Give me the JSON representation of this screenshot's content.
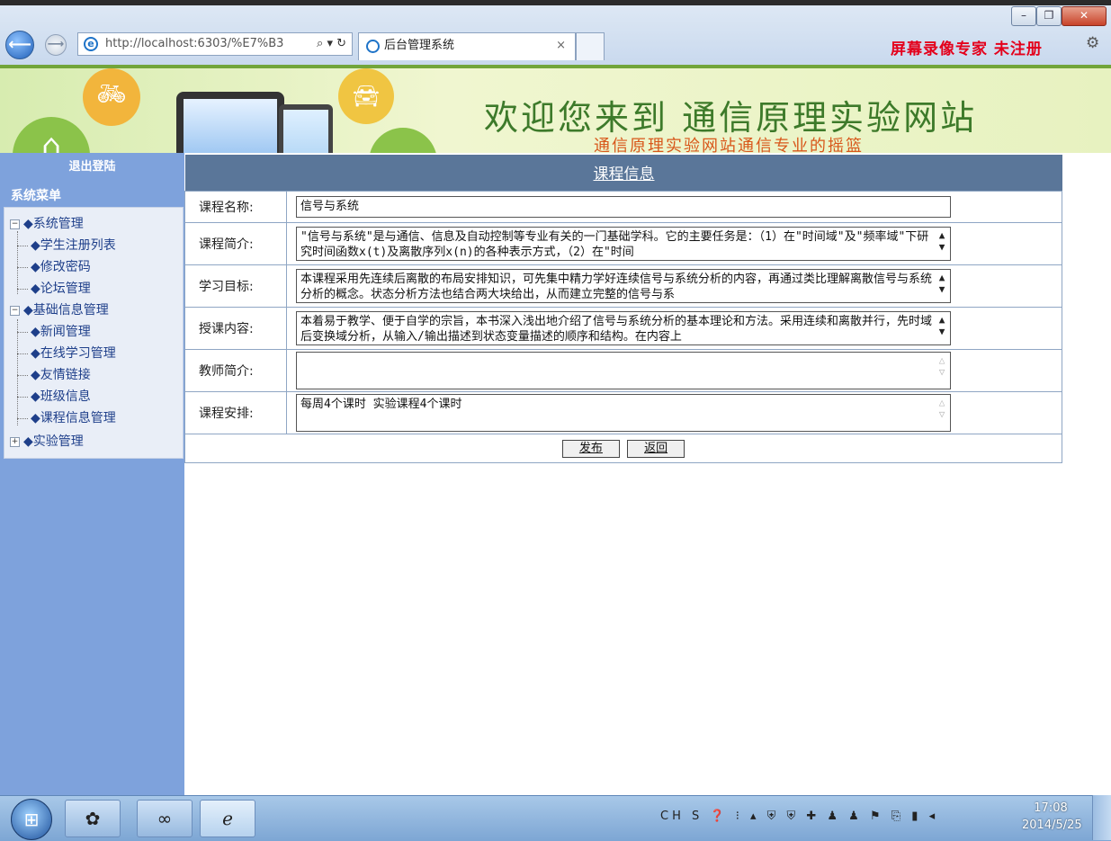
{
  "browser": {
    "address": "http://localhost:6303/%E7%B3",
    "address_tools": "⌕ ▾ ↻",
    "tab_title": "后台管理系统",
    "tab_close": "×",
    "recorder_text": "屏幕录像专家 未注册",
    "window_buttons": [
      "–",
      "❐",
      "✕"
    ]
  },
  "banner": {
    "welcome": "欢迎您来到 通信原理实验网站",
    "subtitle": "通信原理实验网站通信专业的摇篮"
  },
  "sidebar": {
    "logout": "退出登陆",
    "menu_title": "系统菜单",
    "groups": [
      {
        "label": "◆系统管理",
        "toggle": "−",
        "items": [
          "◆学生注册列表",
          "◆修改密码",
          "◆论坛管理"
        ]
      },
      {
        "label": "◆基础信息管理",
        "toggle": "−",
        "items": [
          "◆新闻管理",
          "◆在线学习管理",
          "◆友情链接",
          "◆班级信息",
          "◆课程信息管理"
        ]
      },
      {
        "label": "◆实验管理",
        "toggle": "+",
        "items": []
      }
    ]
  },
  "form": {
    "title": "课程信息",
    "fields": {
      "course_name": {
        "label": "课程名称:",
        "value": "信号与系统"
      },
      "course_intro": {
        "label": "课程简介:",
        "value": "\"信号与系统\"是与通信、信息及自动控制等专业有关的一门基础学科。它的主要任务是：（1）在\"时间域\"及\"频率域\"下研究时间函数x(t)及离散序列x(n)的各种表示方式，（2）在\"时间"
      },
      "learning_goal": {
        "label": "学习目标:",
        "value": "本课程采用先连续后离散的布局安排知识，可先集中精力学好连续信号与系统分析的内容，再通过类比理解离散信号与系统分析的概念。状态分析方法也结合两大块给出，从而建立完整的信号与系"
      },
      "teaching_content": {
        "label": "授课内容:",
        "value": "本着易于教学、便于自学的宗旨，本书深入浅出地介绍了信号与系统分析的基本理论和方法。采用连续和离散并行，先时域后变换域分析，从输入/输出描述到状态变量描述的顺序和结构。在内容上"
      },
      "teacher_intro": {
        "label": "教师简介:",
        "value": ""
      },
      "schedule": {
        "label": "课程安排:",
        "value": "每周4个课时 实验课程4个课时"
      }
    },
    "publish_label": "发布",
    "back_label": "返回"
  },
  "taskbar": {
    "tray_text": "CH S ❓ ⁝ ▴ ⛨ ⛨ ✚ ♟ ♟ ⚑ ⎘ ▮ ◂",
    "time": "17:08",
    "date": "2014/5/25"
  }
}
